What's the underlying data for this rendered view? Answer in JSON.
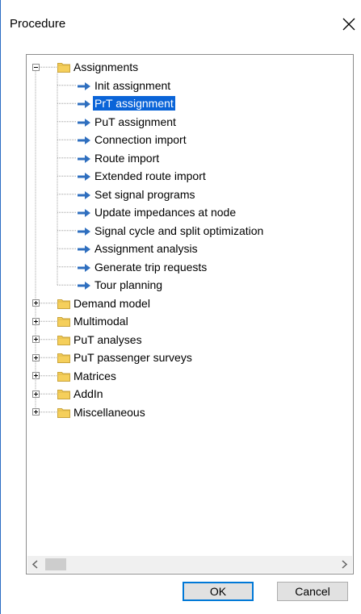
{
  "dialog": {
    "title": "Procedure",
    "close_glyph": "X"
  },
  "tree": {
    "groups": [
      {
        "label": "Assignments",
        "expanded": true,
        "children": [
          {
            "label": "Init assignment"
          },
          {
            "label": "PrT assignment",
            "selected": true
          },
          {
            "label": "PuT assignment"
          },
          {
            "label": "Connection import"
          },
          {
            "label": "Route import"
          },
          {
            "label": "Extended route import"
          },
          {
            "label": "Set signal programs"
          },
          {
            "label": "Update impedances at node"
          },
          {
            "label": "Signal cycle and split optimization"
          },
          {
            "label": "Assignment analysis"
          },
          {
            "label": "Generate trip requests"
          },
          {
            "label": "Tour planning"
          }
        ]
      },
      {
        "label": "Demand model",
        "expanded": false
      },
      {
        "label": "Multimodal",
        "expanded": false
      },
      {
        "label": "PuT analyses",
        "expanded": false
      },
      {
        "label": "PuT passenger surveys",
        "expanded": false
      },
      {
        "label": "Matrices",
        "expanded": false
      },
      {
        "label": "AddIn",
        "expanded": false
      },
      {
        "label": "Miscellaneous",
        "expanded": false
      }
    ]
  },
  "buttons": {
    "ok_label": "OK",
    "cancel_label": "Cancel"
  },
  "colors": {
    "selection": "#0a64d8",
    "arrow": "#2f6fbf",
    "folder": "#f5cf5b",
    "focus_border": "#0078d7"
  },
  "icons": {
    "folder": "folder-icon",
    "arrow": "arrow-right-icon",
    "expand": "plus-box-icon",
    "collapse": "minus-box-icon",
    "close": "close-icon"
  }
}
